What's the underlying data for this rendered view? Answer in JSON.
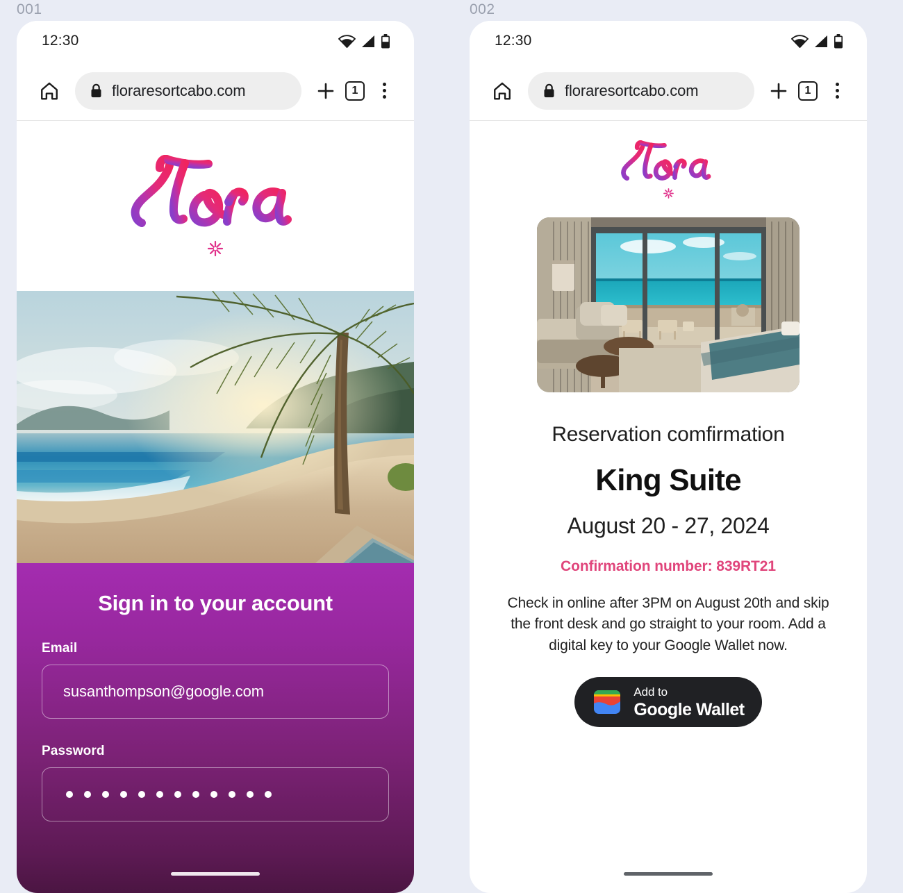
{
  "background_color": "#e9ecf5",
  "brand": {
    "name": "Flora",
    "gradient_from": "#8a3ec9",
    "gradient_to": "#f0245f",
    "accent_pink": "#e0457b",
    "panel_purple": "#a42cb0"
  },
  "frames": [
    {
      "label": "001",
      "status_bar": {
        "time": "12:30",
        "icons": [
          "wifi-icon",
          "signal-icon",
          "battery-icon"
        ]
      },
      "browser": {
        "home_icon": "home-icon",
        "lock_icon": "lock-icon",
        "url": "floraresortcabo.com",
        "new_tab_icon": "plus-icon",
        "tab_count": "1",
        "menu_icon": "overflow-menu-icon"
      },
      "logo": {
        "wordmark": "Flora",
        "mark": "asterisk-flower-icon"
      },
      "hero": {
        "alt": "tropical-beach-sunset-photo"
      },
      "signin": {
        "heading": "Sign in to your account",
        "email": {
          "label": "Email",
          "value": "susanthompson@google.com",
          "placeholder": "Email"
        },
        "password": {
          "label": "Password",
          "value": "••••••••••••",
          "masked_char_count": 12,
          "placeholder": "Password"
        }
      }
    },
    {
      "label": "002",
      "status_bar": {
        "time": "12:30",
        "icons": [
          "wifi-icon",
          "signal-icon",
          "battery-icon"
        ]
      },
      "browser": {
        "home_icon": "home-icon",
        "lock_icon": "lock-icon",
        "url": "floraresortcabo.com",
        "new_tab_icon": "plus-icon",
        "tab_count": "1",
        "menu_icon": "overflow-menu-icon"
      },
      "logo": {
        "wordmark": "Flora",
        "mark": "asterisk-flower-icon"
      },
      "room_photo": {
        "alt": "hotel-suite-ocean-view-photo"
      },
      "reservation": {
        "subtitle": "Reservation comfirmation",
        "room_name": "King Suite",
        "dates": "August 20 - 27, 2024",
        "confirmation": "Confirmation number: 839RT21",
        "instructions": "Check in online after 3PM on August 20th and skip the front desk and go straight to your room. Add a digital key to your Google Wallet now.",
        "wallet_button": {
          "line1": "Add to",
          "line2": "Google Wallet",
          "icon": "google-wallet-icon"
        }
      }
    }
  ]
}
